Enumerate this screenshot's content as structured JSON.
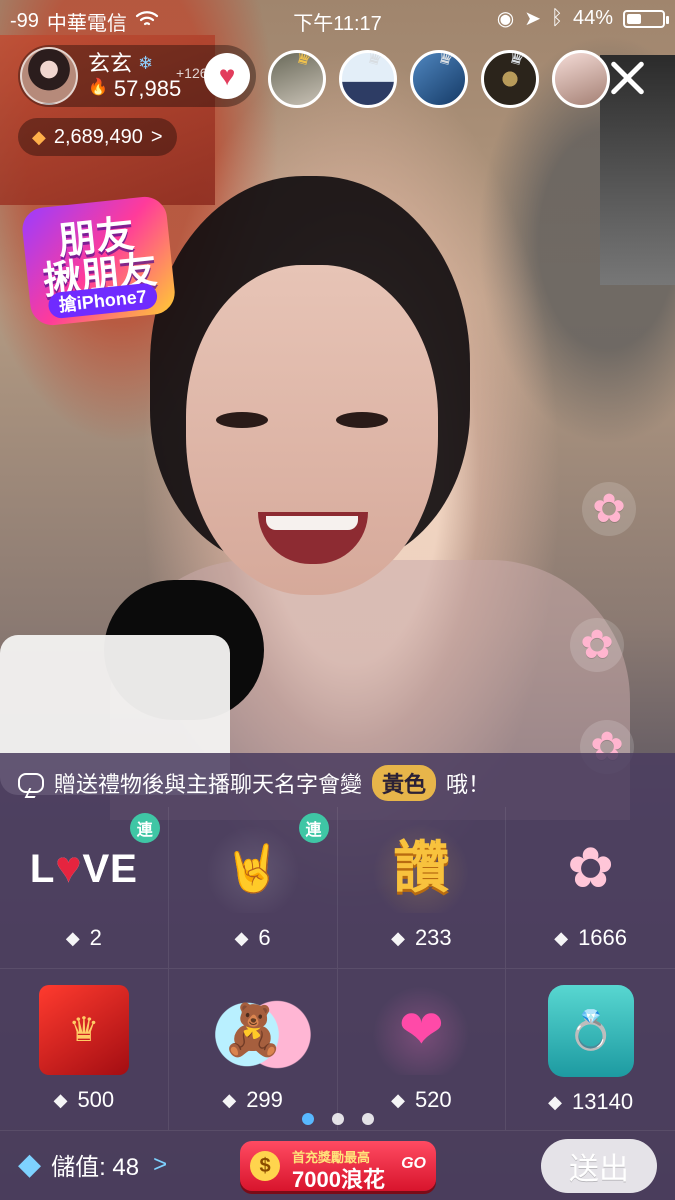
{
  "status": {
    "signal": "-99",
    "carrier": "中華電信",
    "time": "下午11:17",
    "battery": "44%"
  },
  "host": {
    "name": "玄玄",
    "followers": "57,985",
    "stamp": "+1266"
  },
  "diamonds": {
    "count": "2,689,490",
    "arrow": ">"
  },
  "promo_badge": {
    "line1": "朋友",
    "line2": "揪朋友",
    "line3": "搶iPhone7"
  },
  "panel": {
    "hint_prefix": "贈送禮物後與主播聊天名字會變",
    "hint_highlight": "黃色",
    "hint_suffix": "哦！",
    "gifts": [
      {
        "name": "LOVE",
        "price": "2",
        "combo": "連"
      },
      {
        "name": "Hands",
        "price": "6",
        "combo": "連"
      },
      {
        "name": "讚",
        "price": "233",
        "combo": ""
      },
      {
        "name": "Sakura",
        "price": "1666",
        "combo": ""
      },
      {
        "name": "Red packet",
        "price": "500",
        "combo": ""
      },
      {
        "name": "Bear hug",
        "price": "299",
        "combo": ""
      },
      {
        "name": "Hearts",
        "price": "520",
        "combo": ""
      },
      {
        "name": "Ring",
        "price": "13140",
        "combo": ""
      }
    ],
    "pager": {
      "active_index": 0,
      "count": 3
    }
  },
  "bottom": {
    "recharge_label": "儲值: 48",
    "recharge_arrow": ">",
    "promo_line1": "首充獎勵最高",
    "promo_line2": "7000浪花",
    "promo_go": "GO",
    "send_label": "送出"
  },
  "icons": {
    "wifi": "wifi-icon",
    "lock_rotation": "rotation-lock-icon",
    "location": "location-arrow-icon",
    "bluetooth": "bluetooth-icon",
    "heart": "heart-icon",
    "close": "close-icon",
    "diamond": "diamond-icon",
    "chat": "chat-icon",
    "flower": "flower-icon"
  }
}
